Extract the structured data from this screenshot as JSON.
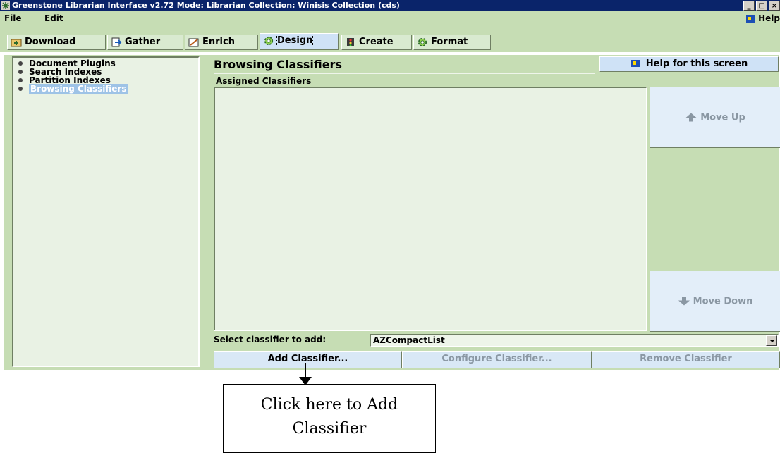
{
  "window": {
    "title": "Greenstone Librarian Interface v2.72  Mode: Librarian  Collection: Winisis Collection (cds)",
    "controls": [
      "_",
      "□",
      "×"
    ]
  },
  "menu": {
    "file": "File",
    "edit": "Edit",
    "help": "Help"
  },
  "tabs": [
    {
      "label": "Download",
      "icon": "download-icon"
    },
    {
      "label": "Gather",
      "icon": "gather-icon"
    },
    {
      "label": "Enrich",
      "icon": "enrich-icon"
    },
    {
      "label": "Design",
      "icon": "design-gear-icon",
      "active": true
    },
    {
      "label": "Create",
      "icon": "create-icon"
    },
    {
      "label": "Format",
      "icon": "format-gear-icon"
    }
  ],
  "sidebar": {
    "items": [
      {
        "label": "Document Plugins"
      },
      {
        "label": "Search Indexes"
      },
      {
        "label": "Partition Indexes"
      },
      {
        "label": "Browsing Classifiers",
        "selected": true
      }
    ]
  },
  "main": {
    "title": "Browsing Classifiers",
    "help_button": "Help for this screen",
    "assigned_label": "Assigned Classifiers",
    "move_up": "Move Up",
    "move_down": "Move Down",
    "select_label": "Select classifier to add:",
    "select_value": "AZCompactList",
    "add_button": "Add Classifier...",
    "configure_button": "Configure Classifier...",
    "remove_button": "Remove Classifier"
  },
  "callout": {
    "line1": "Click here to Add",
    "line2": "Classifier"
  },
  "colors": {
    "accent_green": "#c6ddb4",
    "title_bar": "#0a246a",
    "button_blue": "#d9e8f6"
  }
}
